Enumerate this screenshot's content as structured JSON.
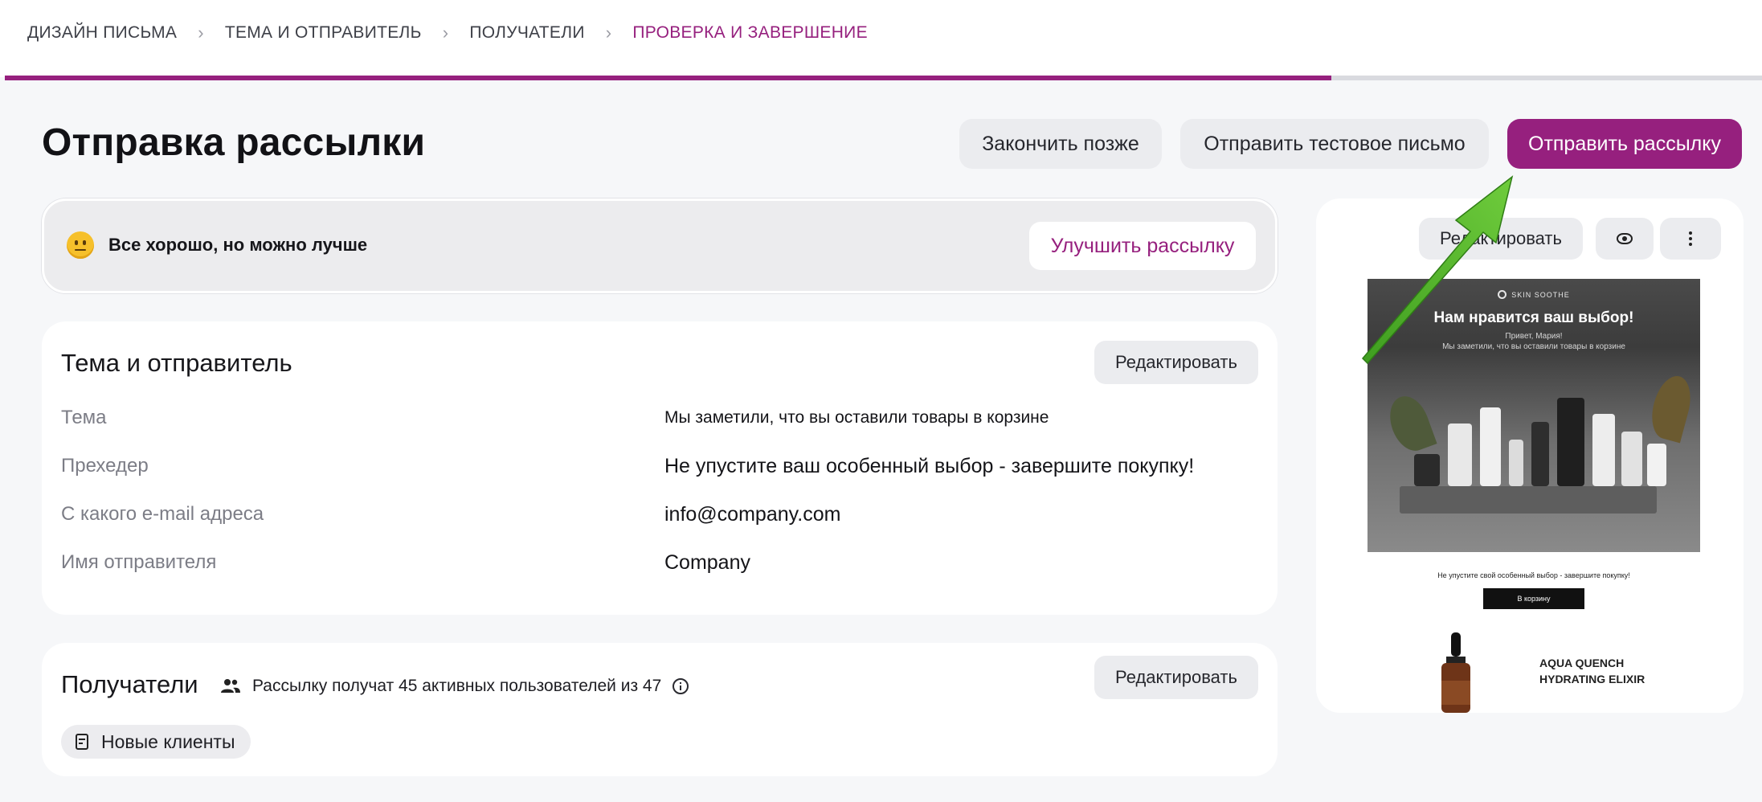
{
  "steps": {
    "items": [
      {
        "label": "ДИЗАЙН ПИСЬМА",
        "active": false
      },
      {
        "label": "ТЕМА И ОТПРАВИТЕЛЬ",
        "active": false
      },
      {
        "label": "ПОЛУЧАТЕЛИ",
        "active": false
      },
      {
        "label": "ПРОВЕРКА И ЗАВЕРШЕНИЕ",
        "active": true
      }
    ],
    "separator": "›",
    "progress_fraction": 0.755
  },
  "header": {
    "title": "Отправка рассылки",
    "finish_later": "Закончить позже",
    "send_test": "Отправить тестовое письмо",
    "send_campaign": "Отправить рассылку"
  },
  "score": {
    "text": "Все хорошо, но можно лучше",
    "improve_button": "Улучшить рассылку"
  },
  "theme_sender": {
    "title": "Тема и отправитель",
    "edit_button": "Редактировать",
    "fields": [
      {
        "label": "Тема",
        "value": "Мы заметили, что вы оставили товары в корзине"
      },
      {
        "label": "Прехедер",
        "value": "Не упустите ваш особенный выбор - завершите покупку!"
      },
      {
        "label": "С какого e-mail адреса",
        "value": "info@company.com"
      },
      {
        "label": "Имя отправителя",
        "value": "Company"
      }
    ]
  },
  "recipients": {
    "title": "Получатели",
    "info": "Рассылку получат 45 активных пользователей из 47",
    "edit_button": "Редактировать",
    "segment": "Новые клиенты"
  },
  "preview": {
    "edit_button": "Редактировать",
    "eye_icon": "eye-icon",
    "more_icon": "more-vertical-icon",
    "email": {
      "brand": "SKIN SOOTHE",
      "title": "Нам нравится ваш выбор!",
      "greeting": "Привет, Мария!",
      "subtitle": "Мы заметили, что вы оставили товары в корзине",
      "preheader": "Не упустите свой особенный выбор - завершите покупку!",
      "cta": "В корзину",
      "product_name": "AQUA QUENCH HYDRATING ELIXIR"
    }
  },
  "colors": {
    "accent": "#96207e",
    "button_gray": "#ebecef",
    "arrow_green": "#4caf2a"
  }
}
